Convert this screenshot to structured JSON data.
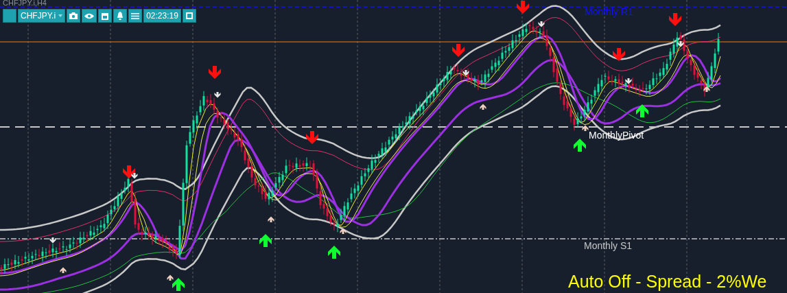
{
  "chart": {
    "symbol_label": "CHFJPY.i,H4",
    "levels": [
      {
        "label": "Monthly R1",
        "kind": "r1"
      },
      {
        "label": "MonthlyPivot",
        "kind": "pivot"
      },
      {
        "label": "Monthly S1",
        "kind": "s1"
      }
    ],
    "status_text": "Auto Off - Spread - 2%We"
  },
  "toolbar": {
    "symbol": "CHFJPY.i",
    "time": "02:23:19"
  }
}
